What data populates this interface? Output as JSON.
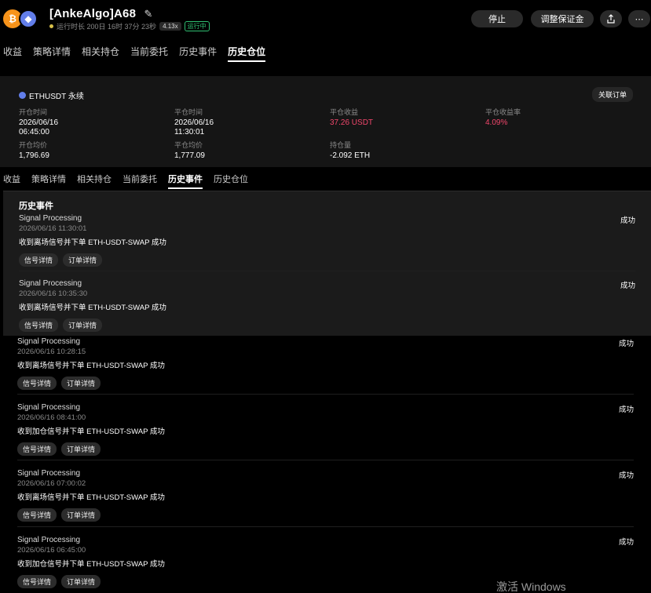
{
  "header": {
    "title": "[AnkeAlgo]A68",
    "runtime": "运行时长 200日 16时 37分 23秒",
    "multiplier": "4.13x",
    "run_status": "运行中",
    "stop_label": "停止",
    "margin_label": "调整保证金",
    "share_icon": "share-icon",
    "more_icon": "more-icon"
  },
  "tabs_top": [
    "收益",
    "策略详情",
    "相关持仓",
    "当前委托",
    "历史事件",
    "历史仓位"
  ],
  "tabs_second": [
    "收益",
    "策略详情",
    "相关持仓",
    "当前委托",
    "历史事件",
    "历史仓位"
  ],
  "position": {
    "symbol": "ETHUSDT 永续",
    "link_label": "关联订单",
    "open_time_label": "开仓时间",
    "open_time_date": "2026/06/16",
    "open_time_time": "06:45:00",
    "close_time_label": "平仓时间",
    "close_time_date": "2026/06/16",
    "close_time_time": "11:30:01",
    "pnl_label": "平仓收益",
    "pnl_value": "37.26 USDT",
    "pnl_rate_label": "平仓收益率",
    "pnl_rate_value": "4.09%",
    "open_avg_label": "开仓均价",
    "open_avg_value": "1,796.69",
    "close_avg_label": "平仓均价",
    "close_avg_value": "1,777.09",
    "qty_label": "持仓量",
    "qty_value": "-2.092 ETH"
  },
  "history": {
    "title": "历史事件",
    "events": [
      {
        "title": "Signal Processing",
        "time": "2026/06/16 11:30:01",
        "desc": "收到离场信号并下单 ETH-USDT-SWAP 成功",
        "status": "成功",
        "btn1": "信号详情",
        "btn2": "订单详情"
      },
      {
        "title": "Signal Processing",
        "time": "2026/06/16 10:35:30",
        "desc": "收到离场信号并下单 ETH-USDT-SWAP 成功",
        "status": "成功",
        "btn1": "信号详情",
        "btn2": "订单详情"
      },
      {
        "title": "Signal Processing",
        "time": "2026/06/16 10:28:15",
        "desc": "收到离场信号并下单 ETH-USDT-SWAP 成功",
        "status": "成功",
        "btn1": "信号详情",
        "btn2": "订单详情"
      },
      {
        "title": "Signal Processing",
        "time": "2026/06/16 08:41:00",
        "desc": "收到加仓信号并下单 ETH-USDT-SWAP 成功",
        "status": "成功",
        "btn1": "信号详情",
        "btn2": "订单详情"
      },
      {
        "title": "Signal Processing",
        "time": "2026/06/16 07:00:02",
        "desc": "收到离场信号并下单 ETH-USDT-SWAP 成功",
        "status": "成功",
        "btn1": "信号详情",
        "btn2": "订单详情"
      },
      {
        "title": "Signal Processing",
        "time": "2026/06/16 06:45:00",
        "desc": "收到加仓信号并下单 ETH-USDT-SWAP 成功",
        "status": "成功",
        "btn1": "信号详情",
        "btn2": "订单详情"
      }
    ]
  },
  "watermark": "激活 Windows",
  "colors": {
    "accent_red": "#f0466b",
    "run_green": "#2fbf71",
    "btc_orange": "#f7931a",
    "eth_blue": "#627eea"
  }
}
